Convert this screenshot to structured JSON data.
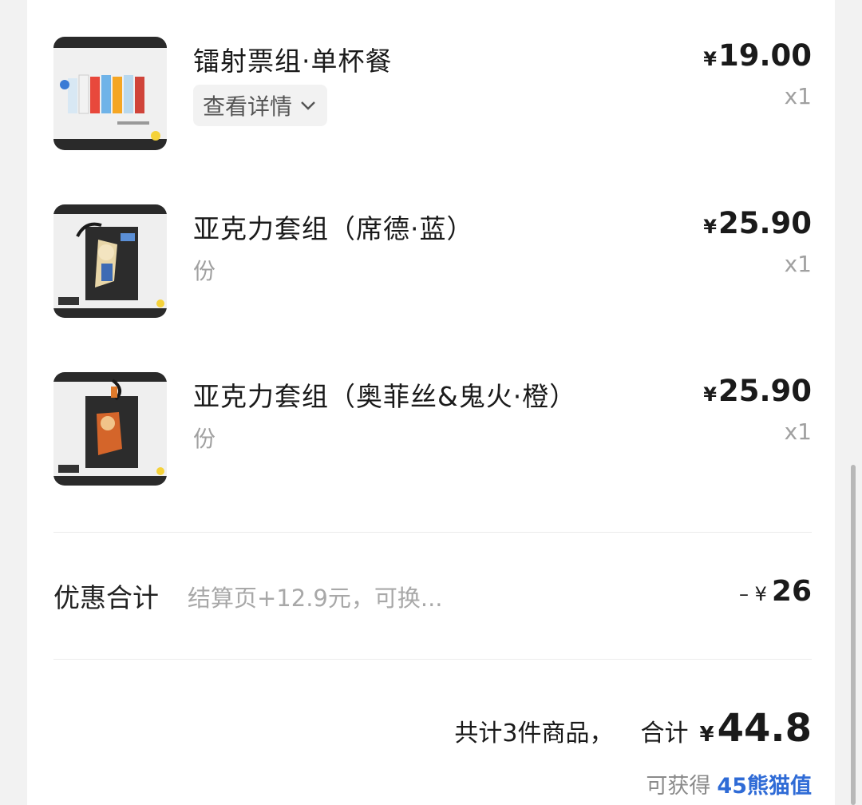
{
  "items": [
    {
      "title": "镭射票组·单杯餐",
      "detail_label": "查看详情",
      "sub": "",
      "currency": "¥",
      "price": "19.00",
      "qty": "x1",
      "image": "ticket-set-image"
    },
    {
      "title": "亚克力套组（席德·蓝）",
      "detail_label": "",
      "sub": "份",
      "currency": "¥",
      "price": "25.90",
      "qty": "x1",
      "image": "acrylic-blue-image"
    },
    {
      "title": "亚克力套组（奥菲丝&鬼火·橙）",
      "detail_label": "",
      "sub": "份",
      "currency": "¥",
      "price": "25.90",
      "qty": "x1",
      "image": "acrylic-orange-image"
    }
  ],
  "discount": {
    "label": "优惠合计",
    "desc": "结算页+12.9元，可换...",
    "prefix": "– ¥",
    "amount": "26"
  },
  "summary": {
    "count_text": "共计3件商品，",
    "total_label": "合计",
    "currency": "¥",
    "total": "44.8",
    "points_label": "可获得",
    "points_value": "45熊猫值"
  },
  "colors": {
    "points_accent": "#2f6bd6",
    "muted_text": "#a0a0a0"
  }
}
